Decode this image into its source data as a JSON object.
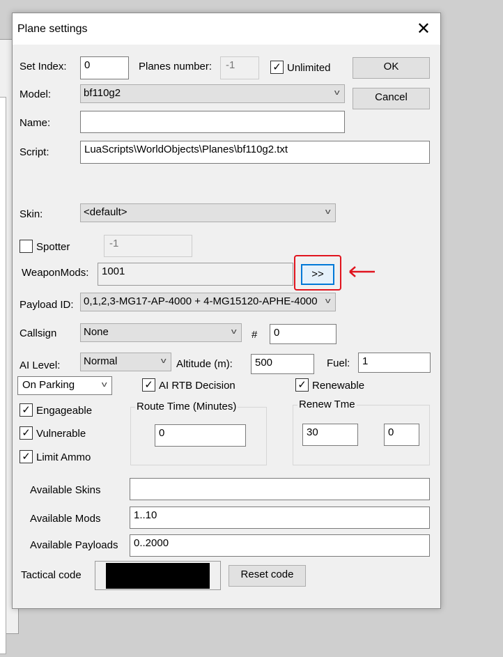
{
  "dialog": {
    "title": "Plane settings"
  },
  "fields": {
    "set_index_label": "Set Index:",
    "set_index": "0",
    "planes_number_label": "Planes number:",
    "planes_number": "-1",
    "unlimited_label": "Unlimited",
    "model_label": "Model:",
    "model": "bf110g2",
    "name_label": "Name:",
    "name": "",
    "script_label": "Script:",
    "script": "LuaScripts\\WorldObjects\\Planes\\bf110g2.txt",
    "skin_label": "Skin:",
    "skin": "<default>",
    "spotter_label": "Spotter",
    "spotter_value": "-1",
    "weaponmods_label": "WeaponMods:",
    "weaponmods": "1001",
    "weaponmods_button": ">>",
    "payload_label": "Payload ID:",
    "payload": "0,1,2,3-MG17-AP-4000 + 4-MG15120-APHE-4000",
    "callsign_label": "Callsign",
    "callsign": "None",
    "hash_label": "#",
    "callsign_number": "0",
    "ai_level_label": "AI Level:",
    "ai_level": "Normal",
    "altitude_label": "Altitude (m):",
    "altitude": "500",
    "fuel_label": "Fuel:",
    "fuel": "1",
    "start_mode": "On Parking",
    "ai_rtb_label": "AI RTB Decision",
    "renewable_label": "Renewable",
    "engageable_label": "Engageable",
    "vulnerable_label": "Vulnerable",
    "limit_ammo_label": "Limit Ammo",
    "route_time_label": "Route Time (Minutes)",
    "route_time": "0",
    "renew_time_label": "Renew Tme",
    "renew_time_a": "30",
    "renew_time_b": "0",
    "available_skins_label": "Available Skins",
    "available_skins": "",
    "available_mods_label": "Available Mods",
    "available_mods": "1..10",
    "available_payloads_label": "Available Payloads",
    "available_payloads": "0..2000",
    "tactical_code_label": "Tactical code"
  },
  "buttons": {
    "ok": "OK",
    "cancel": "Cancel",
    "reset_code": "Reset code"
  },
  "checkboxes": {
    "unlimited": true,
    "spotter": false,
    "ai_rtb": true,
    "renewable": true,
    "engageable": true,
    "vulnerable": true,
    "limit_ammo": true
  },
  "colors": {
    "annotation": "#e0141e",
    "focus": "#0078d7",
    "tactical_code": "#000000"
  }
}
